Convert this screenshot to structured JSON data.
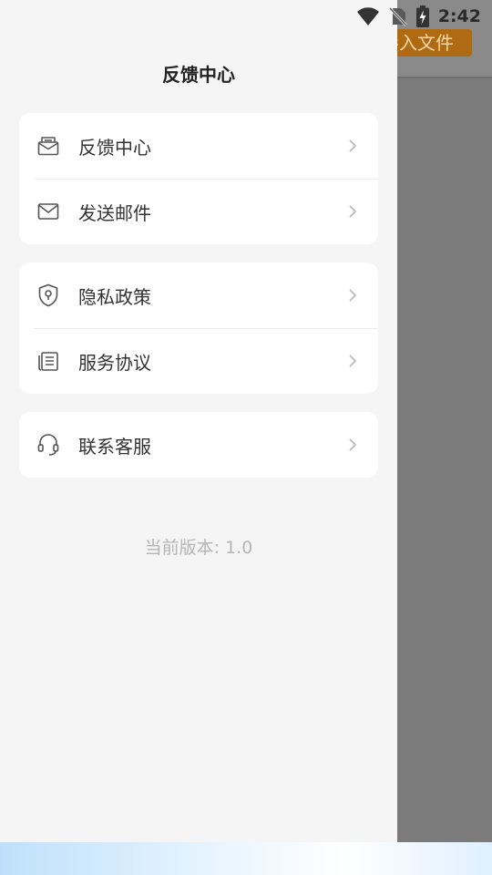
{
  "status_bar": {
    "time": "2:42",
    "icons": [
      "wifi-icon",
      "no-sim-icon",
      "battery-charging-icon"
    ]
  },
  "background": {
    "button_label": "导入文件"
  },
  "drawer": {
    "title": "反馈中心",
    "groups": [
      {
        "items": [
          {
            "label": "反馈中心",
            "icon": "feedback-mail-icon"
          },
          {
            "label": "发送邮件",
            "icon": "envelope-icon"
          }
        ]
      },
      {
        "items": [
          {
            "label": "隐私政策",
            "icon": "shield-icon"
          },
          {
            "label": "服务协议",
            "icon": "document-stack-icon"
          }
        ]
      },
      {
        "items": [
          {
            "label": "联系客服",
            "icon": "headset-icon"
          }
        ]
      }
    ],
    "version_text": "当前版本: 1.0"
  },
  "colors": {
    "drawer_bg": "#f4f5f4",
    "card_bg": "#ffffff",
    "accent_button": "#b06a12",
    "text_primary": "#333333",
    "text_muted": "#b5b5b5"
  }
}
